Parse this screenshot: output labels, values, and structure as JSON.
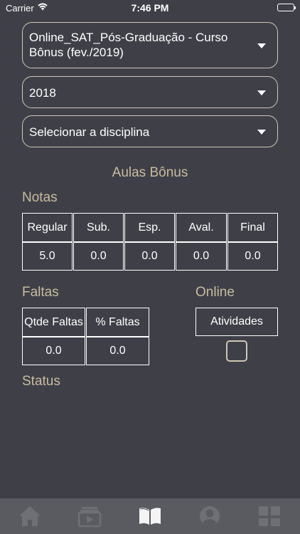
{
  "status_bar": {
    "carrier": "Carrier",
    "time": "7:46 PM"
  },
  "selectors": {
    "course": "Online_SAT_Pós-Graduação - Curso Bônus (fev./2019)",
    "year": "2018",
    "discipline": "Selecionar a disciplina"
  },
  "page_title": "Aulas Bônus",
  "notas": {
    "title": "Notas",
    "headers": [
      "Regular",
      "Sub.",
      "Esp.",
      "Aval.",
      "Final"
    ],
    "values": [
      "5.0",
      "0.0",
      "0.0",
      "0.0",
      "0.0"
    ]
  },
  "faltas": {
    "title": "Faltas",
    "headers": [
      "Qtde Faltas",
      "% Faltas"
    ],
    "values": [
      "0.0",
      "0.0"
    ]
  },
  "online": {
    "title": "Online",
    "header": "Atividades",
    "checked": false
  },
  "status": {
    "title": "Status"
  },
  "tabbar": {
    "items": [
      "home-icon",
      "videos-icon",
      "book-icon",
      "profile-icon",
      "menu-grid-icon"
    ],
    "active": "book-icon"
  },
  "colors": {
    "background": "#3f4047",
    "accent": "#c8bc9f",
    "tabbar": "#5a5b60",
    "tab_inactive": "#6f7075",
    "tab_active": "#f4f4f4"
  }
}
